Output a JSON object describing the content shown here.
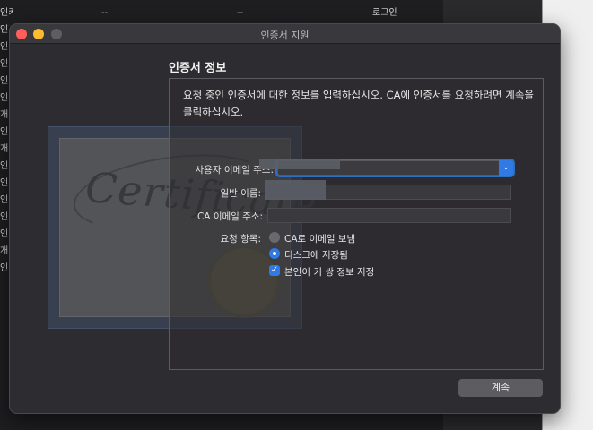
{
  "background_window": {
    "rows": [
      {
        "c0": "인키",
        "c1": "--",
        "c2": "--",
        "c3": "로그인"
      },
      {
        "c0": "인",
        "c1": "",
        "c2": "",
        "c3": ""
      },
      {
        "c0": "인",
        "c1": "",
        "c2": "",
        "c3": ""
      },
      {
        "c0": "인",
        "c1": "",
        "c2": "",
        "c3": ""
      },
      {
        "c0": "인",
        "c1": "",
        "c2": "",
        "c3": ""
      },
      {
        "c0": "인",
        "c1": "",
        "c2": "",
        "c3": ""
      },
      {
        "c0": "개",
        "c1": "",
        "c2": "",
        "c3": ""
      },
      {
        "c0": "인",
        "c1": "",
        "c2": "",
        "c3": ""
      },
      {
        "c0": "개",
        "c1": "",
        "c2": "",
        "c3": ""
      },
      {
        "c0": "인",
        "c1": "",
        "c2": "",
        "c3": ""
      },
      {
        "c0": "인",
        "c1": "",
        "c2": "",
        "c3": ""
      },
      {
        "c0": "인",
        "c1": "",
        "c2": "",
        "c3": ""
      },
      {
        "c0": "인",
        "c1": "",
        "c2": "",
        "c3": ""
      },
      {
        "c0": "인",
        "c1": "",
        "c2": "",
        "c3": ""
      },
      {
        "c0": "개",
        "c1": "",
        "c2": "",
        "c3": ""
      },
      {
        "c0": "인",
        "c1": "",
        "c2": "",
        "c3": ""
      }
    ]
  },
  "dialog": {
    "title": "인증서 지원",
    "section_title": "인증서 정보",
    "intro": "요청 중인 인증서에 대한 정보를 입력하십시오. CA에 인증서를 요청하려면 계속을 클릭하십시오.",
    "cert_art_text": "Certificate",
    "fields": {
      "user_email_label": "사용자 이메일 주소:",
      "user_email_value": "",
      "common_name_label": "일반 이름:",
      "common_name_value": "",
      "ca_email_label": "CA 이메일 주소:",
      "ca_email_value": ""
    },
    "request": {
      "label": "요청 항목:",
      "options": [
        {
          "label": "CA로 이메일 보냄",
          "selected": false
        },
        {
          "label": "디스크에 저장됨",
          "selected": true
        }
      ],
      "checkbox": {
        "label": "본인이 키 쌍 정보 지정",
        "checked": true
      }
    },
    "continue_label": "계속"
  },
  "colors": {
    "accent": "#2f7ae5",
    "dialog_bg": "#2d2c30",
    "close": "#ff5f57",
    "minimize": "#febc2e"
  }
}
